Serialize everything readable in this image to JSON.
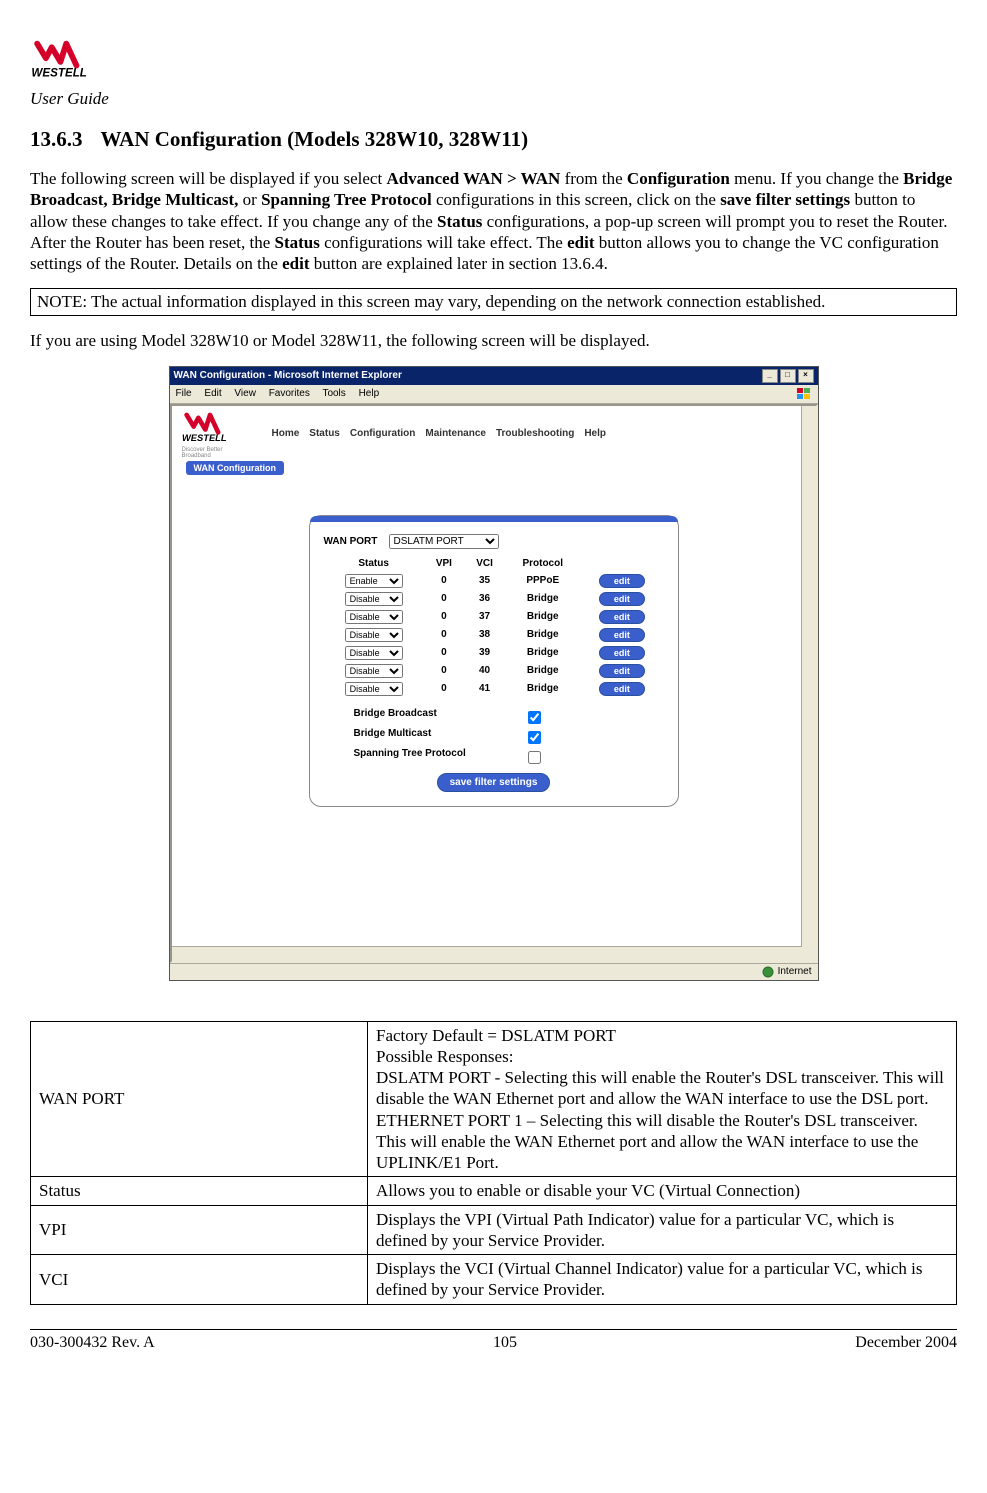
{
  "header": {
    "user_guide": "User Guide"
  },
  "section": {
    "number": "13.6.3",
    "title": "WAN Configuration (Models 328W10, 328W11)"
  },
  "para1": {
    "p1": "The following screen will be displayed if you select ",
    "b1": "Advanced WAN > WAN",
    "p2": " from the ",
    "b2": "Configuration",
    "p3": " menu. If you change the ",
    "b3": "Bridge Broadcast, Bridge Multicast,",
    "p4": " or ",
    "b4": "Spanning Tree Protocol",
    "p5": " configurations in this screen, click on the ",
    "b5": "save filter settings",
    "p6": " button to allow these changes to take effect. If you change any of the ",
    "b6": "Status",
    "p7": " configurations, a pop-up screen will prompt you to reset the Router. After the Router has been reset, the ",
    "b7": "Status",
    "p8": " configurations will take effect. The ",
    "b8": "edit",
    "p9": " button allows you to change the VC configuration settings of the Router. Details on the ",
    "b9": "edit",
    "p10": " button are explained later in section 13.6.4."
  },
  "note": "NOTE: The actual information displayed in this screen may vary, depending on the network connection established.",
  "para2": "If you are using Model 328W10 or Model 328W11, the following screen will be displayed.",
  "ie": {
    "title": "WAN Configuration - Microsoft Internet Explorer",
    "menu": {
      "file": "File",
      "edit": "Edit",
      "view": "View",
      "favorites": "Favorites",
      "tools": "Tools",
      "help": "Help"
    },
    "status": "Internet"
  },
  "app": {
    "tagline": "Discover Better Broadband",
    "nav": {
      "home": "Home",
      "status": "Status",
      "config": "Configuration",
      "maint": "Maintenance",
      "trouble": "Troubleshooting",
      "help": "Help"
    },
    "breadcrumb": "WAN Configuration"
  },
  "panel": {
    "wan_port_label": "WAN PORT",
    "wan_port_value": "DSLATM PORT",
    "headers": {
      "status": "Status",
      "vpi": "VPI",
      "vci": "VCI",
      "protocol": "Protocol"
    },
    "rows": [
      {
        "status": "Enable",
        "vpi": "0",
        "vci": "35",
        "protocol": "PPPoE",
        "edit": "edit"
      },
      {
        "status": "Disable",
        "vpi": "0",
        "vci": "36",
        "protocol": "Bridge",
        "edit": "edit"
      },
      {
        "status": "Disable",
        "vpi": "0",
        "vci": "37",
        "protocol": "Bridge",
        "edit": "edit"
      },
      {
        "status": "Disable",
        "vpi": "0",
        "vci": "38",
        "protocol": "Bridge",
        "edit": "edit"
      },
      {
        "status": "Disable",
        "vpi": "0",
        "vci": "39",
        "protocol": "Bridge",
        "edit": "edit"
      },
      {
        "status": "Disable",
        "vpi": "0",
        "vci": "40",
        "protocol": "Bridge",
        "edit": "edit"
      },
      {
        "status": "Disable",
        "vpi": "0",
        "vci": "41",
        "protocol": "Bridge",
        "edit": "edit"
      }
    ],
    "filters": {
      "bb": "Bridge Broadcast",
      "bm": "Bridge Multicast",
      "stp": "Spanning Tree Protocol"
    },
    "save": "save filter settings"
  },
  "desc_table": [
    {
      "name": "WAN PORT",
      "desc": "Factory Default = DSLATM PORT\nPossible Responses:\nDSLATM PORT - Selecting this will enable the Router's DSL transceiver. This will disable the WAN Ethernet port and allow the WAN interface to use the DSL port.\nETHERNET PORT 1 – Selecting this will disable the Router's DSL transceiver. This will enable the WAN Ethernet port and allow the WAN interface to use the UPLINK/E1 Port."
    },
    {
      "name": "Status",
      "desc": "Allows you to enable or disable your VC (Virtual Connection)"
    },
    {
      "name": "VPI",
      "desc": "Displays the VPI (Virtual Path Indicator) value for a particular VC, which is defined by your Service Provider."
    },
    {
      "name": "VCI",
      "desc": "Displays the VCI (Virtual Channel Indicator) value for a particular VC, which is defined by your Service Provider."
    }
  ],
  "footer": {
    "left": "030-300432 Rev. A",
    "center": "105",
    "right": "December 2004"
  }
}
